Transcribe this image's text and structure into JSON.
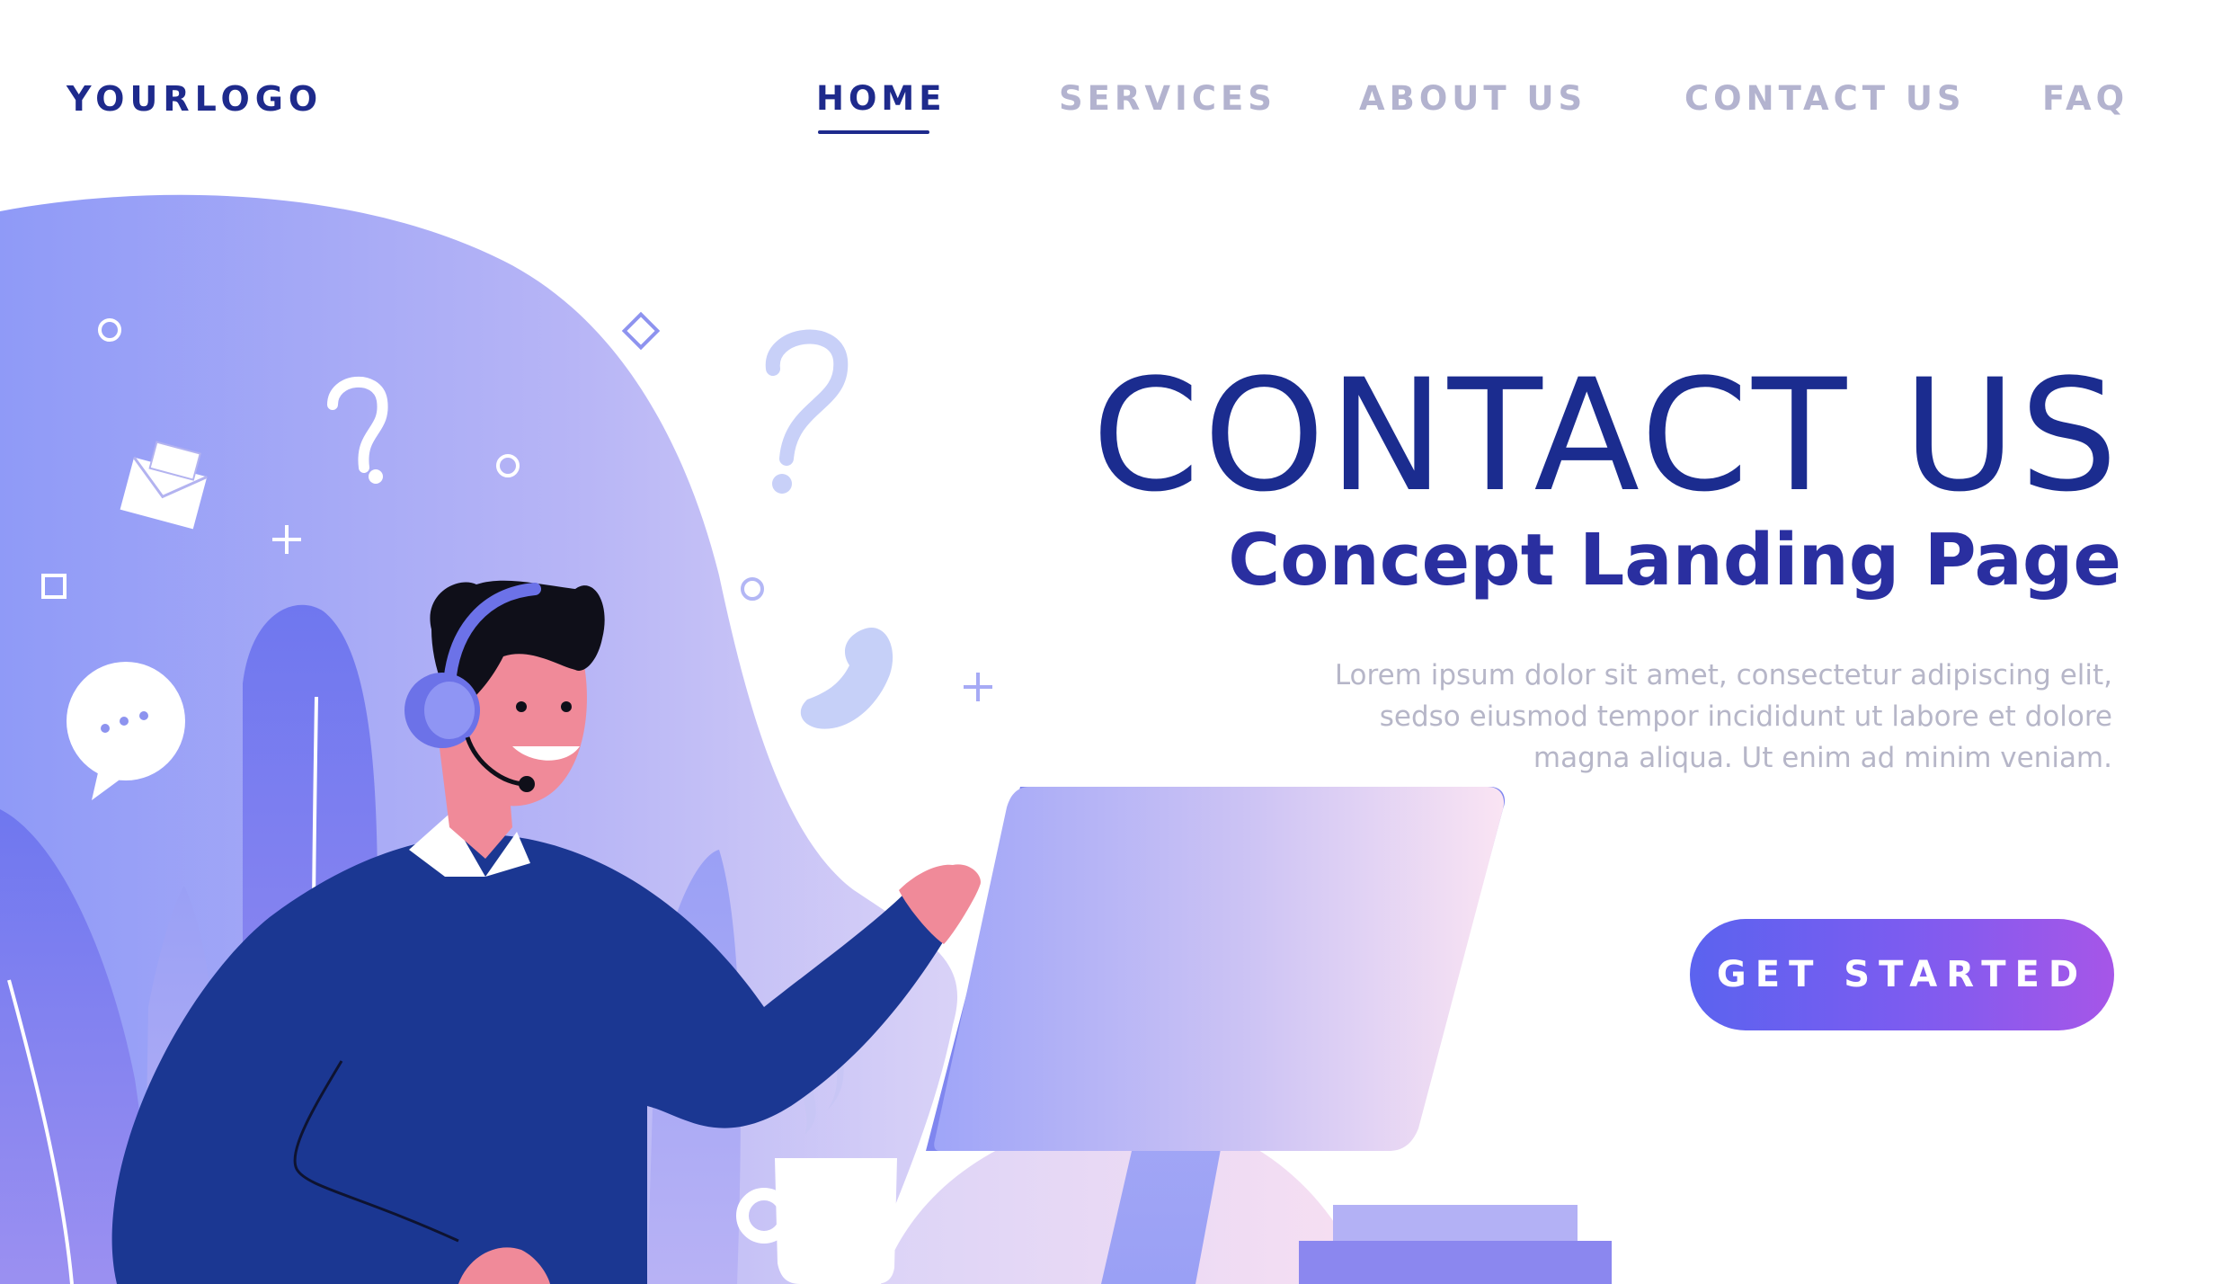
{
  "logo": {
    "text": "YOURLOGO"
  },
  "nav": {
    "items": [
      {
        "label": "HOME",
        "active": true
      },
      {
        "label": "SERVICES",
        "active": false
      },
      {
        "label": "ABOUT US",
        "active": false
      },
      {
        "label": "CONTACT US",
        "active": false
      },
      {
        "label": "FAQ",
        "active": false
      }
    ]
  },
  "hero": {
    "title": "CONTACT US",
    "subtitle": "Concept Landing Page",
    "description_lines": [
      "Lorem ipsum dolor sit amet, consectetur adipiscing elit,",
      "sedso eiusmod tempor incididunt ut labore et dolore",
      "magna aliqua. Ut enim ad minim veniam."
    ],
    "cta_label": "GET STARTED"
  },
  "illustration": {
    "icons": [
      "question-mark-icon",
      "envelope-icon",
      "chat-bubble-icon",
      "phone-icon",
      "headset-icon",
      "coffee-cup-icon",
      "monitor-icon"
    ]
  },
  "colors": {
    "brand_dark": "#1e2a8c",
    "nav_inactive": "#b3b3cf",
    "cta_gradient_start": "#5b63ef",
    "cta_gradient_end": "#a656e8"
  }
}
